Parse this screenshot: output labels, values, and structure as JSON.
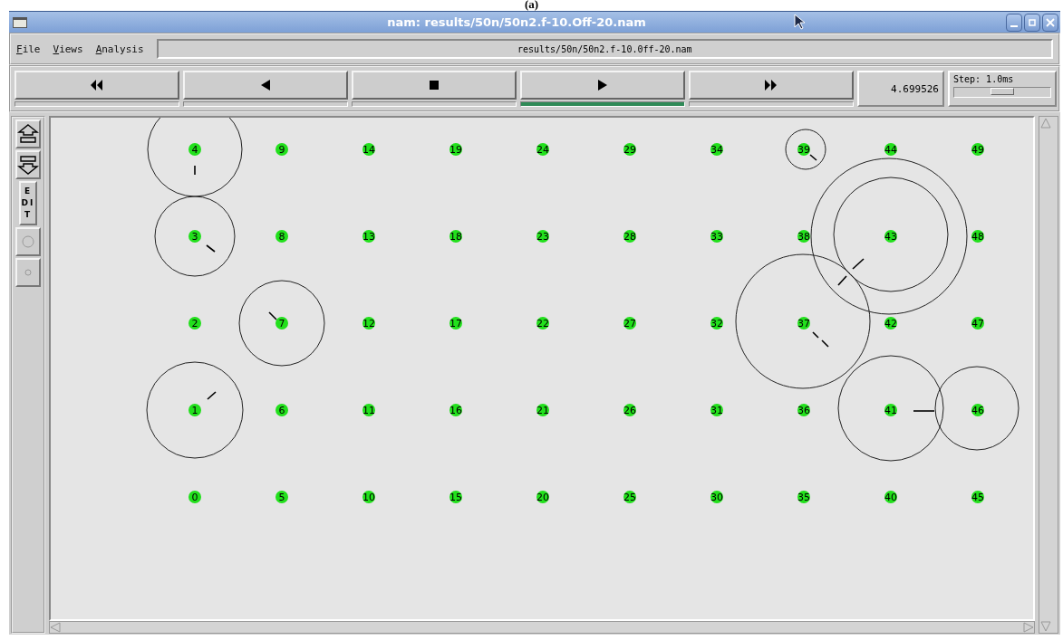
{
  "caption": "(a)",
  "window": {
    "title": "nam: results/50n/50n2.f-10.Off-20.nam"
  },
  "menu": [
    {
      "label": "File"
    },
    {
      "label": "Views"
    },
    {
      "label": "Analysis"
    }
  ],
  "file_field": {
    "value": "results/50n/50n2.f-10.0ff-20.nam"
  },
  "transport": [
    {
      "kind": "rewind",
      "selected": false
    },
    {
      "kind": "back",
      "selected": false
    },
    {
      "kind": "stop",
      "selected": false
    },
    {
      "kind": "play",
      "selected": true
    },
    {
      "kind": "forward",
      "selected": false
    }
  ],
  "time": "4.699526",
  "step": {
    "label": "Step: 1.0ms",
    "level": 0.5
  },
  "tools": [
    {
      "kind": "zoom-in"
    },
    {
      "kind": "zoom-out"
    },
    {
      "kind": "edit",
      "label": "EDIT"
    },
    {
      "kind": "circle-large"
    },
    {
      "kind": "circle-small"
    }
  ],
  "node_rows": [
    [
      "4",
      "9",
      "14",
      "19",
      "24",
      "29",
      "34",
      "39",
      "44",
      "49"
    ],
    [
      "3",
      "8",
      "13",
      "18",
      "23",
      "28",
      "33",
      "38",
      "43",
      "48"
    ],
    [
      "2",
      "7",
      "12",
      "17",
      "22",
      "27",
      "32",
      "37",
      "42",
      "47"
    ],
    [
      "1",
      "6",
      "11",
      "16",
      "21",
      "26",
      "31",
      "36",
      "41",
      "46"
    ],
    [
      "0",
      "5",
      "10",
      "15",
      "20",
      "25",
      "30",
      "35",
      "40",
      "45"
    ]
  ]
}
